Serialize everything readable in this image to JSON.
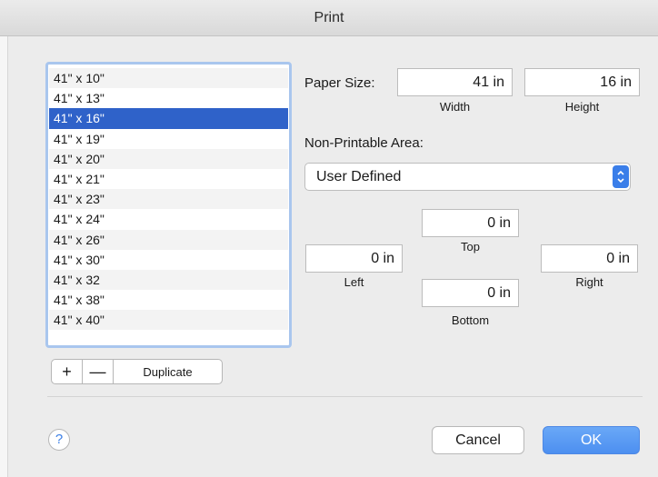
{
  "window": {
    "title": "Print"
  },
  "paper_list": {
    "items": [
      "41\" x 10\"",
      "41\" x 13\"",
      "41\" x 16\"",
      "41\" x 19\"",
      "41\" x 20\"",
      "41\" x 21\"",
      "41\" x 23\"",
      "41\" x 24\"",
      "41\" x 26\"",
      "41\" x 30\"",
      "41\" x 32",
      "41\" x 38\"",
      "41\" x 40\""
    ],
    "selected": "41\" x 16\""
  },
  "list_controls": {
    "add": "+",
    "remove": "—",
    "duplicate": "Duplicate"
  },
  "paper_size": {
    "label": "Paper Size:",
    "width_value": "41 in",
    "width_label": "Width",
    "height_value": "16 in",
    "height_label": "Height"
  },
  "non_printable": {
    "label": "Non-Printable Area:",
    "selected": "User Defined",
    "top_value": "0 in",
    "top_label": "Top",
    "left_value": "0 in",
    "left_label": "Left",
    "right_value": "0 in",
    "right_label": "Right",
    "bottom_value": "0 in",
    "bottom_label": "Bottom"
  },
  "footer": {
    "help": "?",
    "cancel": "Cancel",
    "ok": "OK"
  },
  "colors": {
    "selection": "#2f62c9",
    "accent": "#4d8ff0",
    "focus_ring": "#a9c6ee"
  }
}
